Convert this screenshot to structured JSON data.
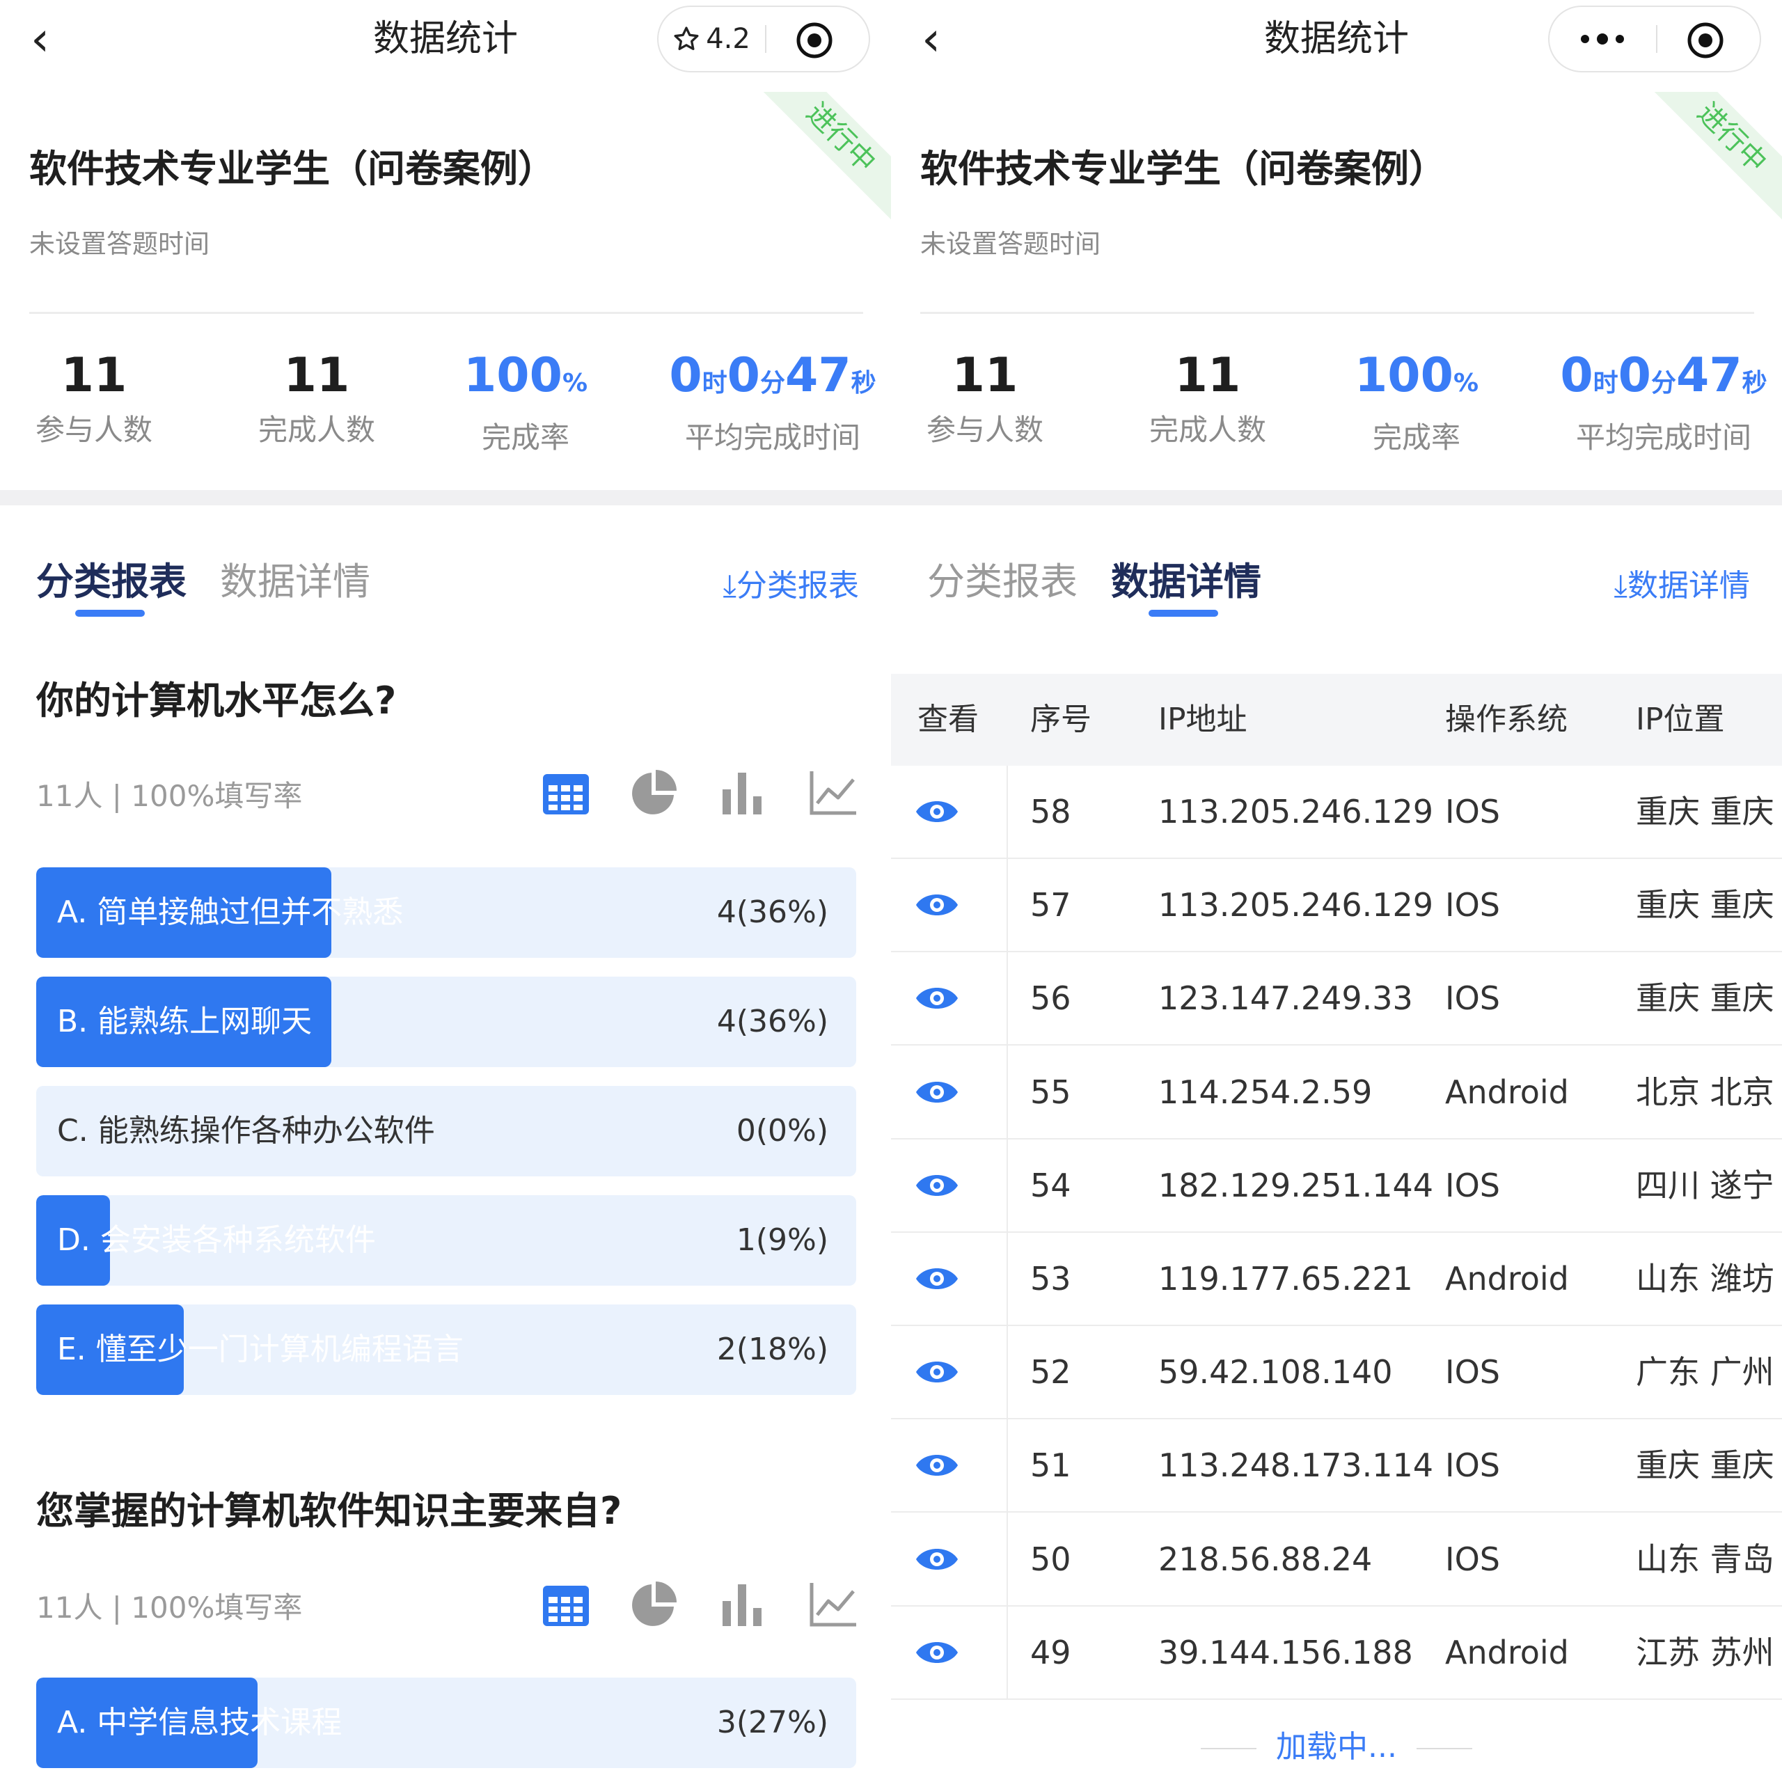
{
  "nav": {
    "title": "数据统计",
    "rating": "4.2"
  },
  "survey": {
    "title": "软件技术专业学生（问卷案例）",
    "subtitle": "未设置答题时间",
    "status": "进行中"
  },
  "stats": {
    "participants_value": "11",
    "participants_label": "参与人数",
    "completed_value": "11",
    "completed_label": "完成人数",
    "rate_value": "100",
    "rate_unit": "%",
    "rate_label": "完成率",
    "time_h": "0",
    "time_h_unit": "时",
    "time_m": "0",
    "time_m_unit": "分",
    "time_s": "47",
    "time_s_unit": "秒",
    "time_label": "平均完成时间"
  },
  "tabs": {
    "category": "分类报表",
    "details": "数据详情",
    "export_category": "⤓分类报表",
    "export_details": "⤓数据详情"
  },
  "questions": [
    {
      "title": "你的计算机水平怎么?",
      "meta": "11人 | 100%填写率",
      "options": [
        {
          "label": "A. 简单接触过但并不熟悉",
          "count": "4(36%)",
          "ratio": 0.36
        },
        {
          "label": "B. 能熟练上网聊天",
          "count": "4(36%)",
          "ratio": 0.36
        },
        {
          "label": "C. 能熟练操作各种办公软件",
          "count": "0(0%)",
          "ratio": 0
        },
        {
          "label": "D. 会安装各种系统软件",
          "count": "1(9%)",
          "ratio": 0.09
        },
        {
          "label": "E. 懂至少一门计算机编程语言",
          "count": "2(18%)",
          "ratio": 0.18
        }
      ]
    },
    {
      "title": "您掌握的计算机软件知识主要来自?",
      "meta": "11人 | 100%填写率",
      "options": [
        {
          "label": "A. 中学信息技术课程",
          "count": "3(27%)",
          "ratio": 0.27
        }
      ]
    }
  ],
  "table": {
    "headers": [
      "查看",
      "序号",
      "IP地址",
      "操作系统",
      "IP位置"
    ],
    "rows": [
      {
        "id": "58",
        "ip": "113.205.246.129",
        "os": "IOS",
        "loc": "重庆 重庆"
      },
      {
        "id": "57",
        "ip": "113.205.246.129",
        "os": "IOS",
        "loc": "重庆 重庆"
      },
      {
        "id": "56",
        "ip": "123.147.249.33",
        "os": "IOS",
        "loc": "重庆 重庆"
      },
      {
        "id": "55",
        "ip": "114.254.2.59",
        "os": "Android",
        "loc": "北京 北京"
      },
      {
        "id": "54",
        "ip": "182.129.251.144",
        "os": "IOS",
        "loc": "四川 遂宁"
      },
      {
        "id": "53",
        "ip": "119.177.65.221",
        "os": "Android",
        "loc": "山东 潍坊"
      },
      {
        "id": "52",
        "ip": "59.42.108.140",
        "os": "IOS",
        "loc": "广东 广州"
      },
      {
        "id": "51",
        "ip": "113.248.173.114",
        "os": "IOS",
        "loc": "重庆 重庆"
      },
      {
        "id": "50",
        "ip": "218.56.88.24",
        "os": "IOS",
        "loc": "山东 青岛"
      },
      {
        "id": "49",
        "ip": "39.144.156.188",
        "os": "Android",
        "loc": "江苏 苏州"
      }
    ],
    "loading": "加载中..."
  },
  "colors": {
    "accent": "#3a7cf6",
    "bar_fill": "#2f78f0",
    "bar_bg": "#eaf2fd",
    "status_green": "#4cc25a"
  },
  "icons": {
    "back": "chevron-left-icon",
    "star": "star-icon",
    "more": "more-dots-icon",
    "record": "target-icon",
    "table": "grid-table-icon",
    "pie": "pie-chart-icon",
    "bar": "bar-chart-icon",
    "line": "line-chart-icon",
    "eye": "eye-icon"
  }
}
